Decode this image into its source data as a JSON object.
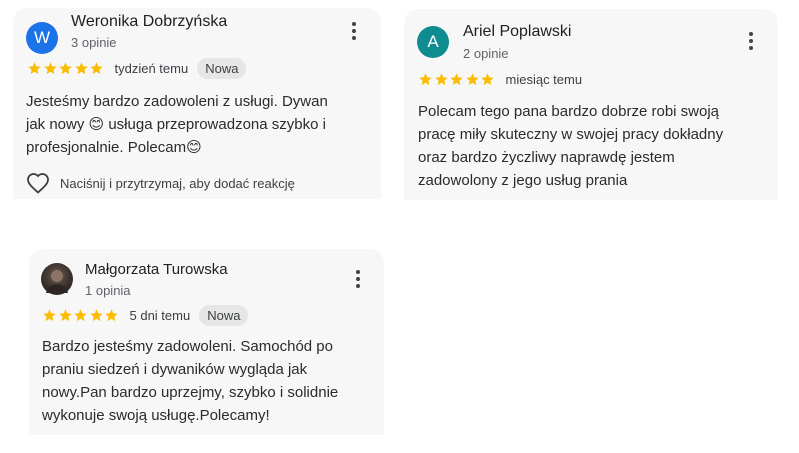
{
  "colors": {
    "card_bg": "#f7f7f8",
    "star": "#fbbc04",
    "avatar_w": "#1a73e8",
    "avatar_a": "#0e8c8f"
  },
  "reviews": [
    {
      "author": "Weronika Dobrzyńska",
      "avatar_letter": "W",
      "review_count": "3 opinie",
      "rating": 5,
      "time": "tydzień temu",
      "badge": "Nowa",
      "lines": [
        "Jesteśmy bardzo zadowoleni z usługi. Dywan",
        "jak nowy 😊 usługa przeprowadzona szybko i",
        "profesjonalnie. Polecam😊"
      ],
      "reaction_hint": "Naciśnij i przytrzymaj, aby dodać reakcję"
    },
    {
      "author": "Ariel Poplawski",
      "avatar_letter": "A",
      "review_count": "2 opinie",
      "rating": 5,
      "time": "miesiąc temu",
      "lines": [
        "Polecam tego pana bardzo dobrze robi swoją",
        "pracę miły skuteczny w swojej pracy dokładny",
        "oraz bardzo życzliwy naprawdę jestem",
        "zadowolony z jego usług prania"
      ]
    },
    {
      "author": "Małgorzata Turowska",
      "review_count": "1 opinia",
      "rating": 5,
      "time": "5 dni temu",
      "badge": "Nowa",
      "lines": [
        "Bardzo jesteśmy zadowoleni. Samochód po",
        "praniu siedzeń i dywaników wygląda jak",
        "nowy.Pan bardzo uprzejmy, szybko i solidnie",
        "wykonuje swoją usługę.Polecamy!"
      ]
    }
  ]
}
